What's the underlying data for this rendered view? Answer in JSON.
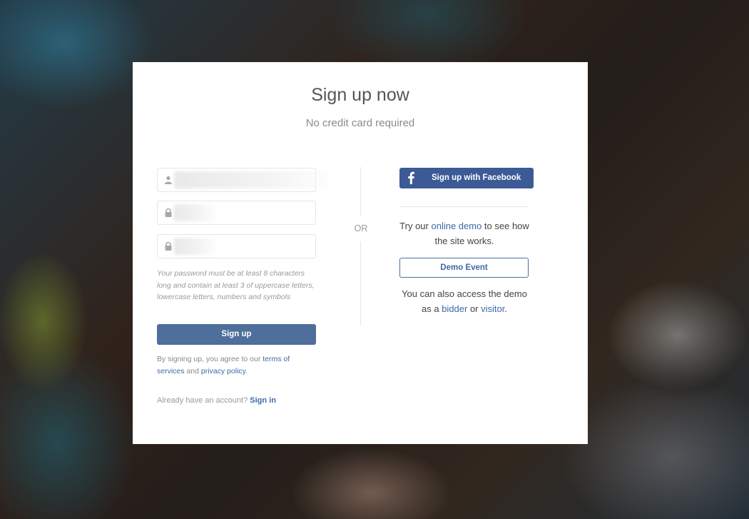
{
  "page": {
    "title": "Sign up now",
    "subtitle": "No credit card required"
  },
  "form": {
    "username": {
      "icon": "user-icon",
      "value": ""
    },
    "password": {
      "icon": "lock-icon",
      "value": ""
    },
    "confirm_password": {
      "icon": "lock-icon",
      "value": ""
    },
    "password_hint": "Your password must be at least 8 characters long and contain at least 3 of uppercase letters, lowercase letters, numbers and symbols",
    "signup_label": "Sign up",
    "terms_prefix": "By signing up, you agree to our ",
    "terms_link": "terms of services",
    "terms_and": " and ",
    "privacy_link": "privacy policy",
    "terms_suffix": ".",
    "already_text": "Already have an account? ",
    "signin_link": "Sign in"
  },
  "divider": {
    "label": "OR"
  },
  "social": {
    "facebook_icon": "facebook-icon",
    "facebook_label": "Sign up with Facebook"
  },
  "demo": {
    "try_prefix": "Try our ",
    "online_demo_link": "online demo",
    "try_suffix": " to see how the site works.",
    "demo_event_label": "Demo Event",
    "access_prefix": "You can also access the demo as a ",
    "bidder_link": "bidder",
    "access_or": " or ",
    "visitor_link": "visitor",
    "access_suffix": "."
  },
  "colors": {
    "primary": "#4e6e9c",
    "facebook": "#3c5a96",
    "link": "#3d6aa8"
  }
}
